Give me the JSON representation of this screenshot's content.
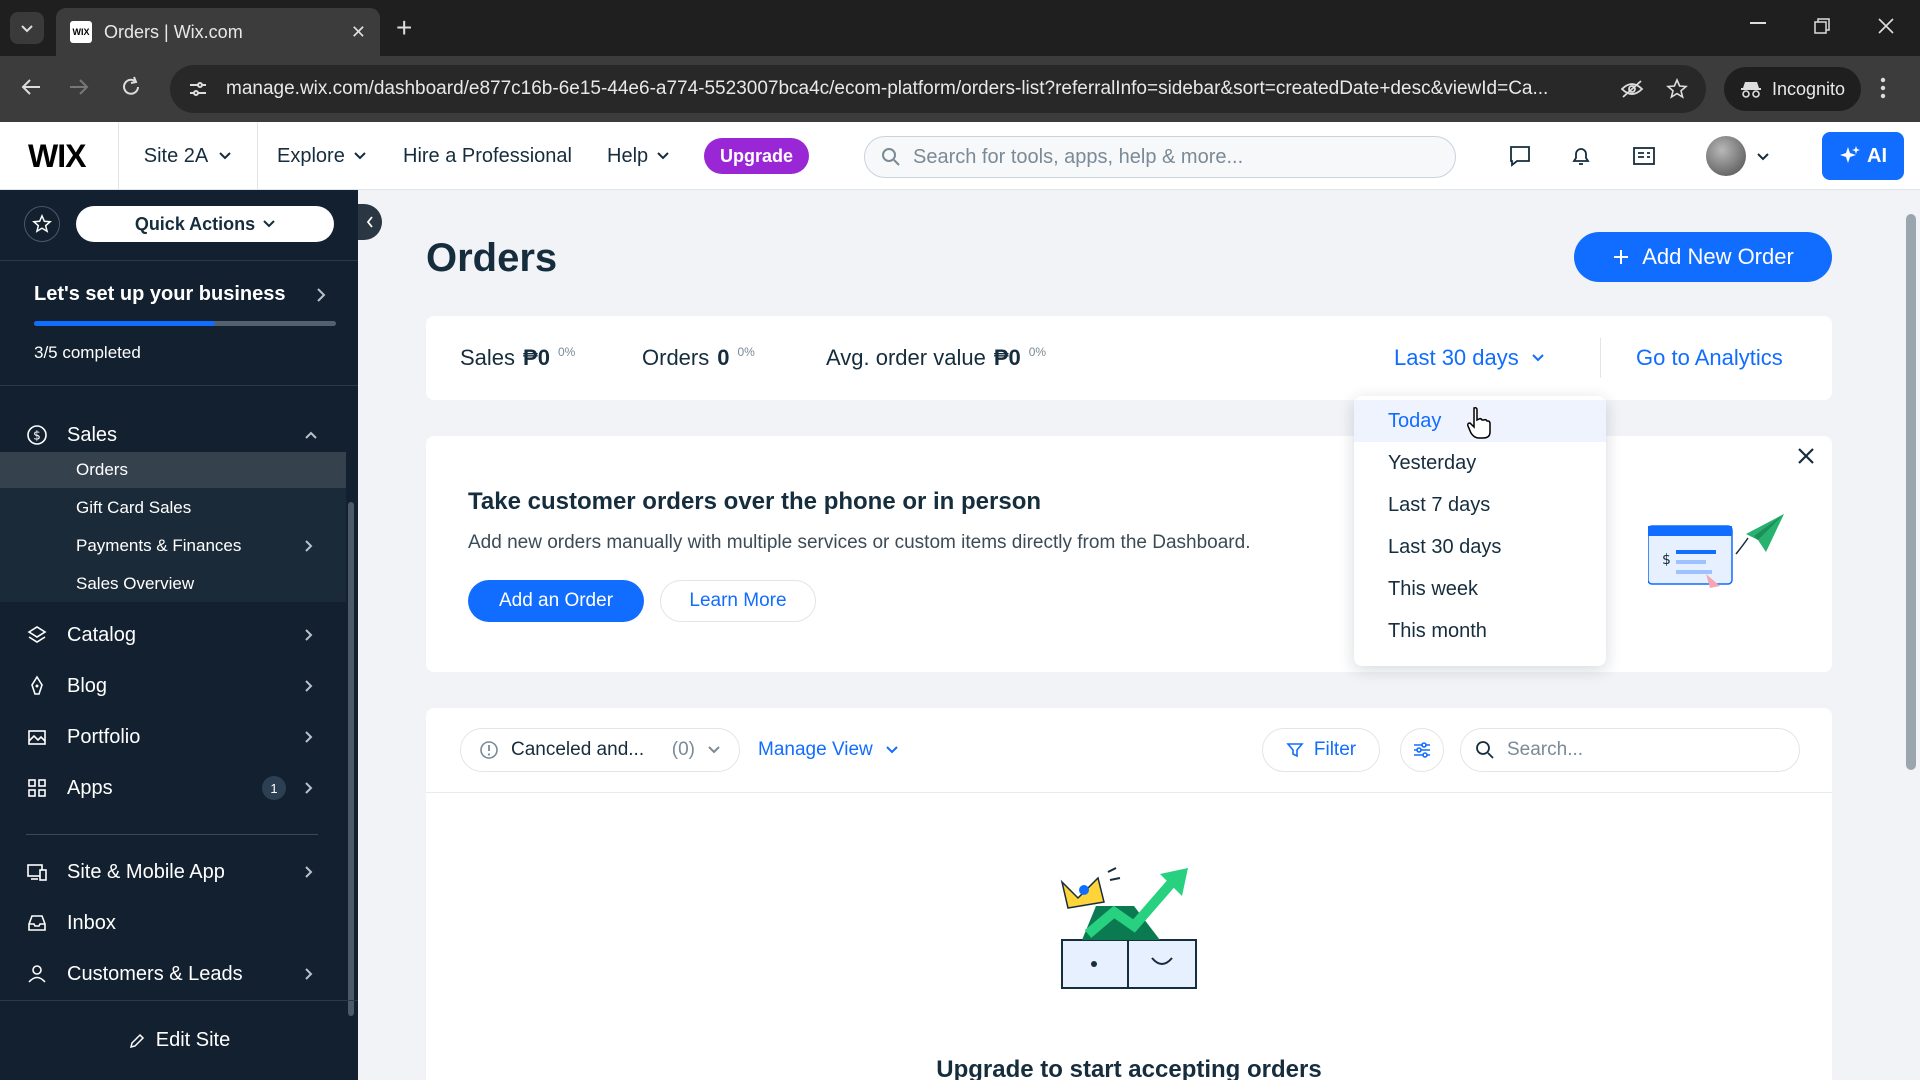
{
  "browser": {
    "tab_title": "Orders | Wix.com",
    "url": "manage.wix.com/dashboard/e877c16b-6e15-44e6-a774-5523007bca4c/ecom-platform/orders-list?referralInfo=sidebar&sort=createdDate+desc&viewId=Ca...",
    "incognito_label": "Incognito"
  },
  "header": {
    "logo": "WIX",
    "site_name": "Site 2A",
    "nav": {
      "explore": "Explore",
      "hire": "Hire a Professional",
      "help": "Help"
    },
    "upgrade": "Upgrade",
    "search_placeholder": "Search for tools, apps, help & more...",
    "ai_label": "AI"
  },
  "sidebar": {
    "quick_actions": "Quick Actions",
    "setup": {
      "title": "Let's set up your business",
      "progress": "3/5 completed",
      "progress_fraction": 0.6
    },
    "sales": {
      "label": "Sales",
      "children": [
        "Orders",
        "Gift Card Sales",
        "Payments & Finances",
        "Sales Overview"
      ]
    },
    "items": {
      "catalog": "Catalog",
      "blog": "Blog",
      "portfolio": "Portfolio",
      "apps": "Apps",
      "apps_badge": "1",
      "site_mobile": "Site & Mobile App",
      "inbox": "Inbox",
      "customers": "Customers & Leads"
    },
    "edit_site": "Edit Site"
  },
  "main": {
    "title": "Orders",
    "add_new_order": "Add New Order",
    "stats": {
      "sales_label": "Sales",
      "sales_value": "₱0",
      "sales_pct": "0%",
      "orders_label": "Orders",
      "orders_value": "0",
      "orders_pct": "0%",
      "aov_label": "Avg. order value",
      "aov_value": "₱0",
      "aov_pct": "0%",
      "range": "Last 30 days",
      "analytics": "Go to Analytics"
    },
    "promo": {
      "title": "Take customer orders over the phone or in person",
      "description": "Add new orders manually with multiple services or custom items directly from the Dashboard.",
      "add_order": "Add an Order",
      "learn_more": "Learn More"
    },
    "table": {
      "view_name": "Canceled and...",
      "view_count": "(0)",
      "manage_view": "Manage View",
      "filter": "Filter",
      "search_placeholder": "Search..."
    },
    "empty_title": "Upgrade to start accepting orders"
  },
  "dropdown": {
    "options": [
      "Today",
      "Yesterday",
      "Last 7 days",
      "Last 30 days",
      "This week",
      "This month"
    ],
    "hovered": "Today"
  },
  "colors": {
    "accent": "#116dff",
    "upgrade": "#9a27d5",
    "sidebar_bg": "#12202f",
    "text": "#162d3d"
  }
}
